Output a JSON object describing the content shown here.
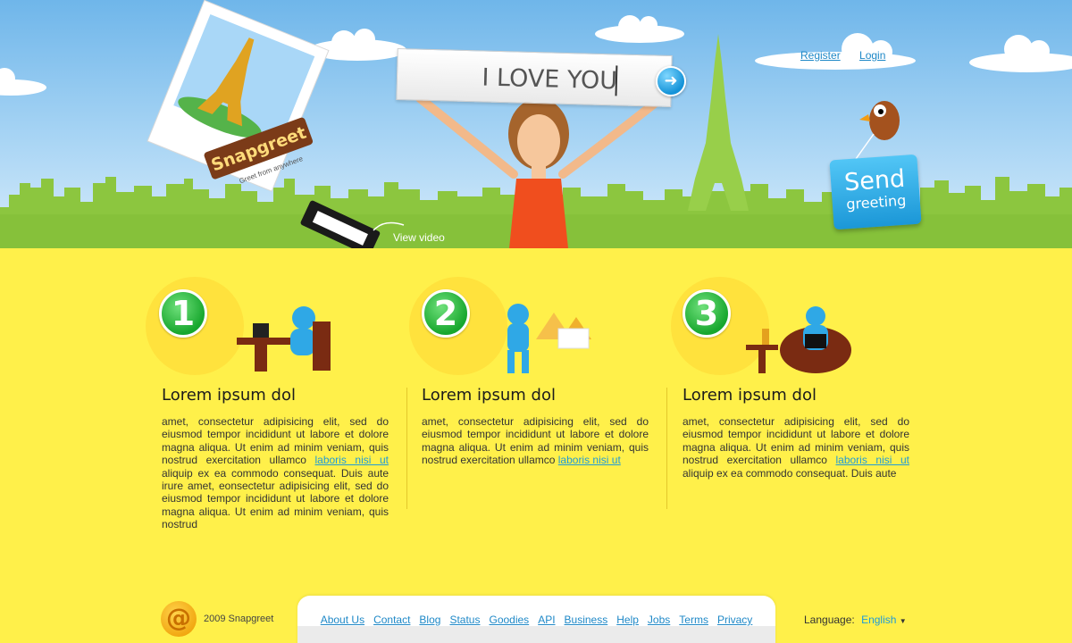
{
  "header": {
    "links": [
      {
        "label": "Register"
      },
      {
        "label": "Login"
      }
    ],
    "logo_text": "Snapgreet",
    "logo_tagline": "Greet from anywhere",
    "message_value": "I LOVE YOU",
    "send_button": {
      "big": "Send",
      "small": "greeting"
    },
    "view_video": "View video"
  },
  "steps": [
    {
      "number": "1",
      "title": "Lorem ipsum dol",
      "body_before": "amet, consectetur adipisicing elit, sed do eiusmod tempor incididunt ut labore et dolore magna aliqua. Ut enim ad minim veniam, quis nostrud exercitation ullamco ",
      "link": "laboris nisi ut",
      "body_after": " aliquip ex ea commodo consequat. Duis aute irure amet, eonsectetur adipisicing elit, sed do eiusmod tempor incididunt ut labore et dolore magna aliqua. Ut enim ad minim veniam, quis nostrud"
    },
    {
      "number": "2",
      "title": "Lorem ipsum dol",
      "body_before": "amet, consectetur adipisicing elit, sed do eiusmod tempor incididunt ut labore et dolore magna aliqua. Ut enim ad minim veniam, quis nostrud exercitation ullamco ",
      "link": "laboris nisi ut",
      "body_after": ""
    },
    {
      "number": "3",
      "title": "Lorem ipsum dol",
      "body_before": "amet, consectetur adipisicing elit, sed do eiusmod tempor incididunt ut labore et dolore magna aliqua. Ut enim ad minim veniam, quis nostrud exercitation ullamco ",
      "link": "laboris nisi ut",
      "body_after": " aliquip ex ea commodo consequat. Duis aute"
    }
  ],
  "footer": {
    "at_symbol": "@",
    "copyright": "2009 Snapgreet",
    "nav": [
      {
        "label": "About Us"
      },
      {
        "label": "Contact"
      },
      {
        "label": "Blog"
      },
      {
        "label": "Status"
      },
      {
        "label": "Goodies"
      },
      {
        "label": "API"
      },
      {
        "label": "Business"
      },
      {
        "label": "Help"
      },
      {
        "label": "Jobs"
      },
      {
        "label": "Terms"
      },
      {
        "label": "Privacy"
      }
    ],
    "language_label": "Language:",
    "language_value": "English"
  },
  "colors": {
    "sky": "#8cc6f0",
    "grass": "#8cc63f",
    "page_yellow": "#fff04a",
    "link_blue": "#1e88c7",
    "accent_blue": "#1b97d7",
    "step_green": "#18a72e"
  },
  "icons": {
    "go": "arrow-right-icon",
    "footer": "at-sign-icon",
    "language": "chevron-down-icon"
  }
}
